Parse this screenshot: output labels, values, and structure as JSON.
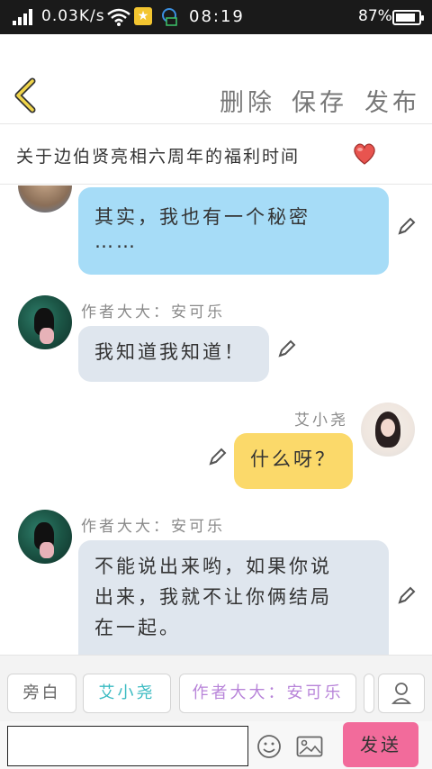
{
  "status_bar": {
    "speed": "0.03K/s",
    "time": "08:19",
    "battery": "87%",
    "battery_level": 0.87
  },
  "toolbar": {
    "delete_label": "删除",
    "save_label": "保存",
    "publish_label": "发布"
  },
  "story": {
    "title": "关于边伯贤亮相六周年的福利时间"
  },
  "messages": [
    {
      "speaker": "",
      "text_lines": [
        "其实，我也有一个秘密",
        "……"
      ]
    },
    {
      "speaker": "作者大大：安可乐",
      "text_lines": [
        "我知道我知道！"
      ]
    },
    {
      "speaker": "艾小尧",
      "text_lines": [
        "什么呀？"
      ]
    },
    {
      "speaker": "作者大大：安可乐",
      "text_lines": [
        "不能说出来哟，如果你说",
        "出来，我就不让你俩结局",
        "在一起。"
      ]
    }
  ],
  "roles": {
    "narrator": "旁白",
    "ai_xiaoyao": "艾小尧",
    "author": "作者大大：安可乐"
  },
  "composer": {
    "input_value": "",
    "send_label": "发送"
  },
  "colors": {
    "send_button": "#f26b9b",
    "bubble_blue": "#a6dcf7",
    "bubble_grey": "#dfe6ee",
    "bubble_yellow": "#fbd96a",
    "role_ai": "#3bbbc2",
    "role_author": "#b884d9",
    "back_arrow": "#f0d54a"
  }
}
